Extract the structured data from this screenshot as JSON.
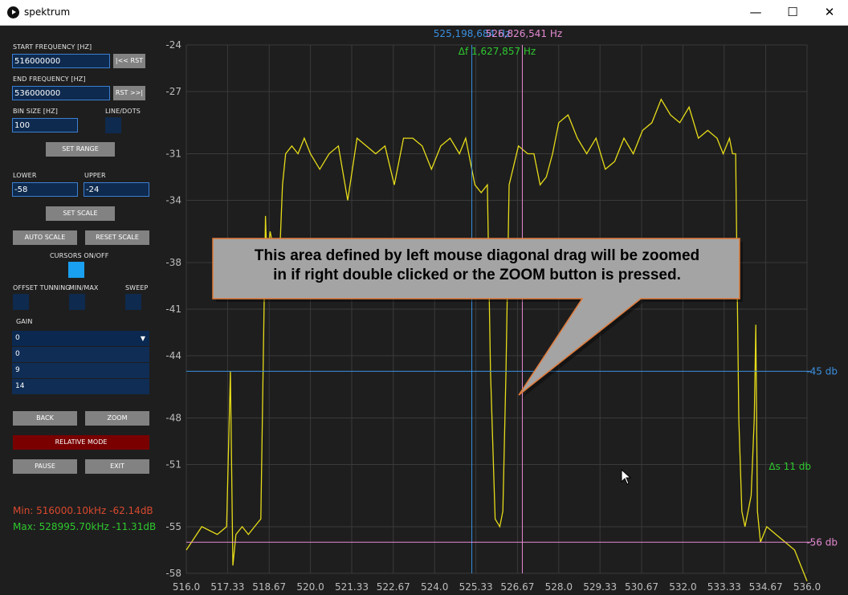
{
  "window": {
    "title": "spektrum",
    "minimize": "—",
    "maximize": "☐",
    "close": "✕"
  },
  "panel": {
    "start_freq_label": "START FREQUENCY [HZ]",
    "start_freq_value": "516000000",
    "rst_start": "|<< RST",
    "end_freq_label": "END FREQUENCY [HZ]",
    "end_freq_value": "536000000",
    "rst_end": "RST >>|",
    "bin_size_label": "BIN SIZE [HZ]",
    "bin_size_value": "100",
    "line_dots_label": "LINE/DOTS",
    "set_range": "SET RANGE",
    "lower_label": "LOWER",
    "upper_label": "UPPER",
    "lower_value": "-58",
    "upper_value": "-24",
    "set_scale": "SET SCALE",
    "auto_scale": "AUTO SCALE",
    "reset_scale": "RESET SCALE",
    "cursors_label": "CURSORS ON/OFF",
    "offset_label": "OFFSET TUNNING",
    "minmax_label": "MIN/MAX",
    "sweep_label": "SWEEP",
    "gain_label": "GAIN",
    "gain_selected": "0",
    "gain_options": [
      "0",
      "9",
      "14"
    ],
    "back": "BACK",
    "zoom": "ZOOM",
    "relative_mode": "RELATIVE MODE",
    "pause": "PAUSE",
    "exit": "EXIT",
    "min_text": "Min: 516000.10kHz -62.14dB",
    "max_text": "Max: 528995.70kHz -11.31dB"
  },
  "colors": {
    "trace": "#e6dc19",
    "cursor_blue": "#3a8fe0",
    "cursor_pink": "#e48ad2",
    "delta_green": "#2ec82e",
    "min_red": "#d9492e",
    "max_green": "#2ec82e",
    "grid": "#3a3a3a",
    "callout_fill": "#a4a4a4",
    "callout_border": "#e07a3a"
  },
  "overlay": {
    "cursor1_freq": "525,198,684 Hz",
    "cursor2_freq": "526,826,541 Hz",
    "delta_f": "Δf 1,627,857 Hz",
    "hline1": "-45 db",
    "hline2": "-56 db",
    "delta_s": "Δs 11 db",
    "callout_line1": "This area defined by left mouse diagonal drag will be zoomed",
    "callout_line2": "in if right double clicked or the ZOOM button is pressed."
  },
  "chart_data": {
    "type": "line",
    "xlim": [
      516.0,
      536.0
    ],
    "ylim": [
      -58,
      -24
    ],
    "x_ticks": [
      "516.0",
      "517.33",
      "518.67",
      "520.0",
      "521.33",
      "522.67",
      "524.0",
      "525.33",
      "526.67",
      "528.0",
      "529.33",
      "530.67",
      "532.0",
      "533.33",
      "534.67",
      "536.0"
    ],
    "y_ticks": [
      "-24",
      "-27",
      "-31",
      "-34",
      "-38",
      "-41",
      "-44",
      "-48",
      "-51",
      "-55",
      "-58"
    ],
    "cursors_x": [
      525.199,
      526.827
    ],
    "cursors_y": [
      -45,
      -56
    ],
    "series": [
      {
        "x": [
          516.0,
          516.5,
          517.0,
          517.3,
          517.42,
          517.5,
          517.6,
          517.8,
          518.0,
          518.2,
          518.4,
          518.55,
          518.6,
          518.7,
          518.8,
          519.0,
          519.1,
          519.2,
          519.4,
          519.6,
          519.8,
          520.0,
          520.3,
          520.6,
          520.9,
          521.2,
          521.5,
          521.8,
          522.1,
          522.4,
          522.7,
          523.0,
          523.3,
          523.6,
          523.9,
          524.2,
          524.5,
          524.8,
          525.0,
          525.3,
          525.5,
          525.7,
          525.8,
          525.95,
          526.1,
          526.2,
          526.3,
          526.4,
          526.7,
          527.0,
          527.2,
          527.4,
          527.6,
          527.8,
          528.0,
          528.3,
          528.6,
          528.9,
          529.2,
          529.5,
          529.8,
          530.1,
          530.4,
          530.7,
          531.0,
          531.3,
          531.6,
          531.9,
          532.2,
          532.5,
          532.8,
          533.1,
          533.3,
          533.5,
          533.6,
          533.7,
          533.8,
          533.9,
          534.0,
          534.1,
          534.2,
          534.3,
          534.35,
          534.4,
          534.5,
          534.7,
          535.0,
          535.3,
          535.6,
          535.9,
          536.0
        ],
        "y": [
          -56.5,
          -55,
          -55.5,
          -55,
          -45,
          -57.5,
          -55.5,
          -55,
          -55.5,
          -55,
          -54.5,
          -35,
          -38,
          -36,
          -37,
          -38,
          -33,
          -31,
          -30.5,
          -31,
          -30,
          -31,
          -32,
          -31,
          -30.5,
          -34,
          -30,
          -30.5,
          -31,
          -30.5,
          -33,
          -30,
          -30,
          -30.5,
          -32,
          -30.5,
          -30,
          -31,
          -30,
          -33,
          -33.5,
          -33,
          -45,
          -54.5,
          -55,
          -54,
          -45,
          -33,
          -30.5,
          -31,
          -31,
          -33,
          -32.5,
          -31,
          -29,
          -28.5,
          -30,
          -31,
          -30,
          -32,
          -31.5,
          -30,
          -31,
          -29.5,
          -29,
          -27.5,
          -28.5,
          -29,
          -28,
          -30,
          -29.5,
          -30,
          -31,
          -30,
          -31,
          -31,
          -48,
          -54,
          -55,
          -54,
          -53,
          -48,
          -42,
          -54,
          -56,
          -55,
          -55.5,
          -56,
          -56.5,
          -58,
          -58.5
        ]
      }
    ]
  }
}
